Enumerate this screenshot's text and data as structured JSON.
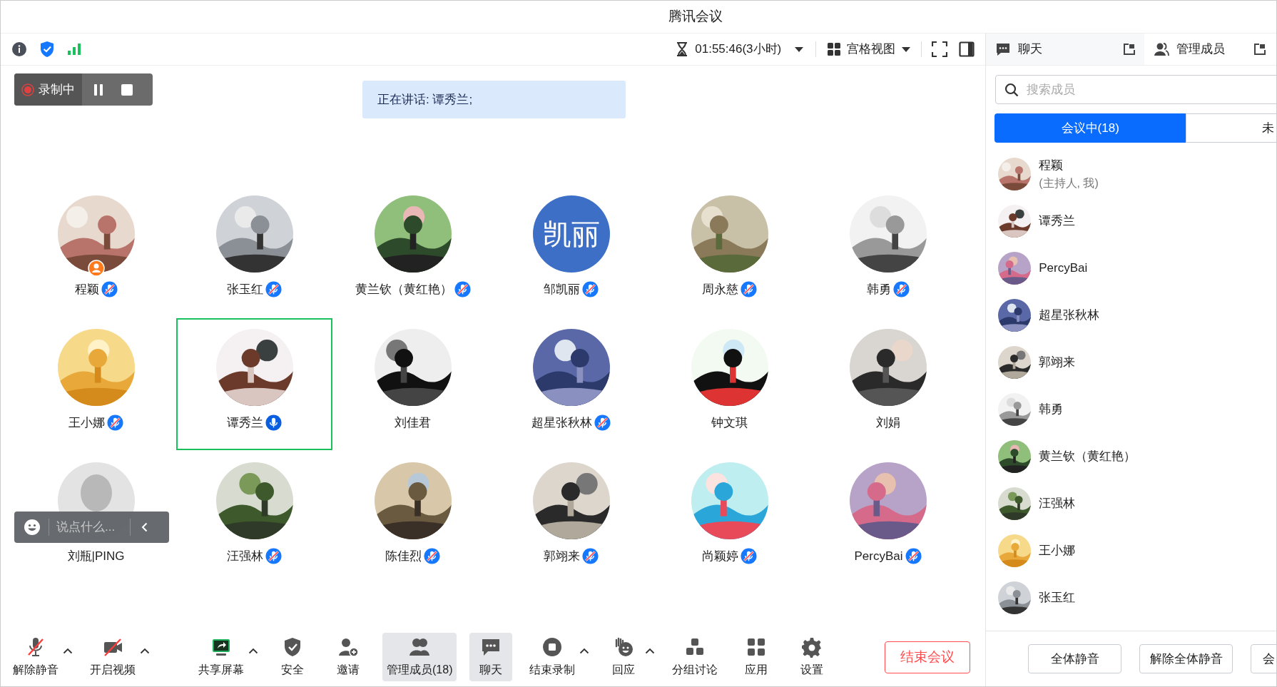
{
  "window": {
    "title": "腾讯会议"
  },
  "top_bar": {
    "duration": "01:55:46(3小时)",
    "view": "宫格视图"
  },
  "recording": {
    "label": "录制中"
  },
  "speaking_banner": "正在讲话: 谭秀兰;",
  "participants": [
    {
      "name": "程颖",
      "kind": "picture",
      "mic_visible": true,
      "muted": true,
      "host": true,
      "selected": false
    },
    {
      "name": "张玉红",
      "kind": "picture",
      "mic_visible": true,
      "muted": true,
      "host": false,
      "selected": false
    },
    {
      "name": "黄兰钦（黄红艳）",
      "kind": "picture",
      "mic_visible": true,
      "muted": true,
      "host": false,
      "selected": false
    },
    {
      "name": "邹凯丽",
      "kind": "text",
      "avatar_text": "凯丽",
      "mic_visible": true,
      "muted": true,
      "host": false,
      "selected": false
    },
    {
      "name": "周永慈",
      "kind": "picture",
      "mic_visible": true,
      "muted": true,
      "host": false,
      "selected": false
    },
    {
      "name": "韩勇",
      "kind": "picture",
      "mic_visible": true,
      "muted": true,
      "host": false,
      "selected": false
    },
    {
      "name": "王小娜",
      "kind": "picture",
      "mic_visible": true,
      "muted": true,
      "host": false,
      "selected": false
    },
    {
      "name": "谭秀兰",
      "kind": "picture",
      "mic_visible": true,
      "muted": false,
      "host": false,
      "selected": true
    },
    {
      "name": "刘佳君",
      "kind": "picture",
      "mic_visible": false,
      "host": false,
      "selected": false
    },
    {
      "name": "超星张秋林",
      "kind": "picture",
      "mic_visible": true,
      "muted": true,
      "host": false,
      "selected": false
    },
    {
      "name": "钟文琪",
      "kind": "picture",
      "mic_visible": false,
      "host": false,
      "selected": false
    },
    {
      "name": "刘娟",
      "kind": "picture",
      "mic_visible": false,
      "host": false,
      "selected": false
    },
    {
      "name": "刘瓶|PING",
      "kind": "placeholder",
      "mic_visible": false,
      "host": false,
      "selected": false
    },
    {
      "name": "汪强林",
      "kind": "picture",
      "mic_visible": true,
      "muted": true,
      "host": false,
      "selected": false
    },
    {
      "name": "陈佳烈",
      "kind": "picture",
      "mic_visible": true,
      "muted": true,
      "host": false,
      "selected": false
    },
    {
      "name": "郭翊来",
      "kind": "picture",
      "mic_visible": true,
      "muted": true,
      "host": false,
      "selected": false
    },
    {
      "name": "尚颖婷",
      "kind": "picture",
      "mic_visible": true,
      "muted": true,
      "host": false,
      "selected": false
    },
    {
      "name": "PercyBai",
      "kind": "picture",
      "mic_visible": true,
      "muted": true,
      "host": false,
      "selected": false
    }
  ],
  "chat_input": {
    "placeholder": "说点什么..."
  },
  "toolbar": [
    {
      "label": "解除静音",
      "kind": "mic-off",
      "caret": true,
      "selected": false
    },
    {
      "label": "开启视频",
      "kind": "camera-off",
      "caret": true,
      "selected": false
    },
    {
      "label": "共享屏幕",
      "kind": "share",
      "caret": true,
      "selected": false
    },
    {
      "label": "安全",
      "kind": "shield",
      "caret": false,
      "selected": false
    },
    {
      "label": "邀请",
      "kind": "invite",
      "caret": false,
      "selected": false
    },
    {
      "label": "管理成员(18)",
      "kind": "members",
      "caret": false,
      "selected": true
    },
    {
      "label": "聊天",
      "kind": "chat",
      "caret": false,
      "selected": true
    },
    {
      "label": "结束录制",
      "kind": "stop",
      "caret": true,
      "selected": false
    },
    {
      "label": "回应",
      "kind": "react",
      "caret": true,
      "selected": false
    },
    {
      "label": "分组讨论",
      "kind": "breakout",
      "caret": false,
      "selected": false
    },
    {
      "label": "应用",
      "kind": "apps",
      "caret": false,
      "selected": false
    },
    {
      "label": "设置",
      "kind": "settings",
      "caret": false,
      "selected": false
    }
  ],
  "end_button": "结束会议",
  "side_panel": {
    "tabs": [
      {
        "label": "聊天"
      },
      {
        "label": "管理成员"
      }
    ],
    "search": {
      "placeholder": "搜索成员"
    },
    "member_tabs": [
      {
        "label": "会议中(18)",
        "selected": true
      },
      {
        "label": "未",
        "selected": false
      }
    ],
    "members": [
      {
        "name": "程颖",
        "note": "(主持人, 我)"
      },
      {
        "name": "谭秀兰"
      },
      {
        "name": "PercyBai"
      },
      {
        "name": "超星张秋林"
      },
      {
        "name": "郭翊来"
      },
      {
        "name": "韩勇"
      },
      {
        "name": "黄兰钦（黄红艳）"
      },
      {
        "name": "汪强林"
      },
      {
        "name": "王小娜"
      },
      {
        "name": "张玉红"
      }
    ],
    "actions": [
      "全体静音",
      "解除全体静音",
      "会"
    ]
  }
}
